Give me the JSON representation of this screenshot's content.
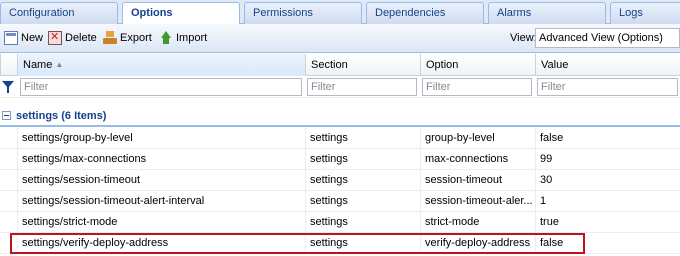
{
  "tabs": [
    {
      "label": "Configuration",
      "active": false
    },
    {
      "label": "Options",
      "active": true
    },
    {
      "label": "Permissions",
      "active": false
    },
    {
      "label": "Dependencies",
      "active": false
    },
    {
      "label": "Alarms",
      "active": false
    },
    {
      "label": "Logs",
      "active": false
    }
  ],
  "toolbar": {
    "new_label": "New",
    "delete_label": "Delete",
    "export_label": "Export",
    "import_label": "Import",
    "view_label": "View:",
    "view_value": "Advanced View  (Options)"
  },
  "columns": {
    "name": "Name",
    "section": "Section",
    "option": "Option",
    "value": "Value"
  },
  "filter_placeholder": "Filter",
  "group": {
    "title": "settings (6 Items)"
  },
  "rows": [
    {
      "name": "settings/group-by-level",
      "section": "settings",
      "option": "group-by-level",
      "value": "false"
    },
    {
      "name": "settings/max-connections",
      "section": "settings",
      "option": "max-connections",
      "value": "99"
    },
    {
      "name": "settings/session-timeout",
      "section": "settings",
      "option": "session-timeout",
      "value": "30"
    },
    {
      "name": "settings/session-timeout-alert-interval",
      "section": "settings",
      "option": "session-timeout-aler...",
      "value": "1"
    },
    {
      "name": "settings/strict-mode",
      "section": "settings",
      "option": "strict-mode",
      "value": "true"
    },
    {
      "name": "settings/verify-deploy-address",
      "section": "settings",
      "option": "verify-deploy-address",
      "value": "false"
    }
  ],
  "colors": {
    "accent": "#15428b",
    "highlight_border": "#c0111f"
  }
}
